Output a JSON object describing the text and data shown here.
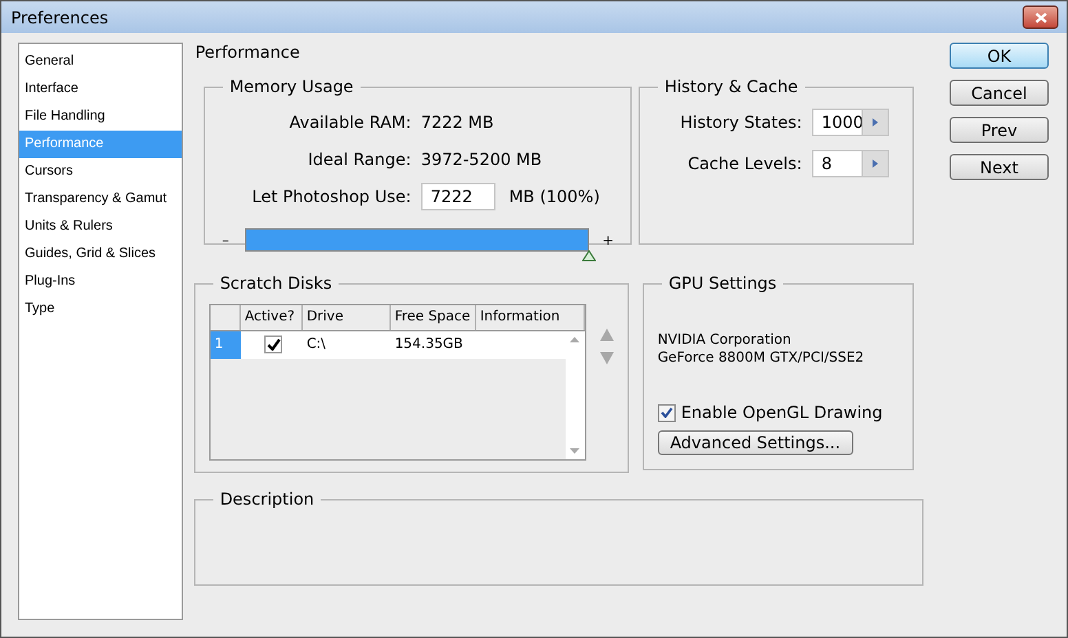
{
  "window": {
    "title": "Preferences"
  },
  "sidebar": {
    "items": [
      {
        "label": "General",
        "selected": false
      },
      {
        "label": "Interface",
        "selected": false
      },
      {
        "label": "File Handling",
        "selected": false
      },
      {
        "label": "Performance",
        "selected": true
      },
      {
        "label": "Cursors",
        "selected": false
      },
      {
        "label": "Transparency & Gamut",
        "selected": false
      },
      {
        "label": "Units & Rulers",
        "selected": false
      },
      {
        "label": "Guides, Grid & Slices",
        "selected": false
      },
      {
        "label": "Plug-Ins",
        "selected": false
      },
      {
        "label": "Type",
        "selected": false
      }
    ]
  },
  "page_title": "Performance",
  "memory_usage": {
    "title": "Memory Usage",
    "available_ram_label": "Available RAM:",
    "available_ram": "7222 MB",
    "ideal_range_label": "Ideal Range:",
    "ideal_range": "3972-5200 MB",
    "use_label": "Let Photoshop Use:",
    "use_value": "7222",
    "use_unit": "MB (100%)",
    "minus": "–",
    "plus": "+",
    "level": 1.0
  },
  "history_cache": {
    "title": "History & Cache",
    "history_states_label": "History States:",
    "history_states": "1000",
    "cache_levels_label": "Cache Levels:",
    "cache_levels": "8"
  },
  "scratch_disks": {
    "title": "Scratch Disks",
    "columns": [
      "Active?",
      "Drive",
      "Free Space",
      "Information"
    ],
    "rows": [
      {
        "number": "1",
        "selected": true,
        "active": true,
        "drive": "C:\\",
        "free_space": "154.35GB"
      }
    ]
  },
  "gpu_settings": {
    "title": "GPU Settings",
    "vendor": "NVIDIA Corporation",
    "renderer": "GeForce 8800M GTX/PCI/SSE2",
    "opengl_label": "Enable OpenGL Drawing",
    "opengl_checked": true,
    "advanced_button": "Advanced Settings..."
  },
  "description": {
    "title": "Description"
  },
  "buttons": [
    {
      "label": "OK",
      "kind": "default"
    },
    {
      "label": "Cancel",
      "kind": "normal"
    },
    {
      "label": "Prev",
      "kind": "normal"
    },
    {
      "label": "Next",
      "kind": "normal"
    }
  ]
}
